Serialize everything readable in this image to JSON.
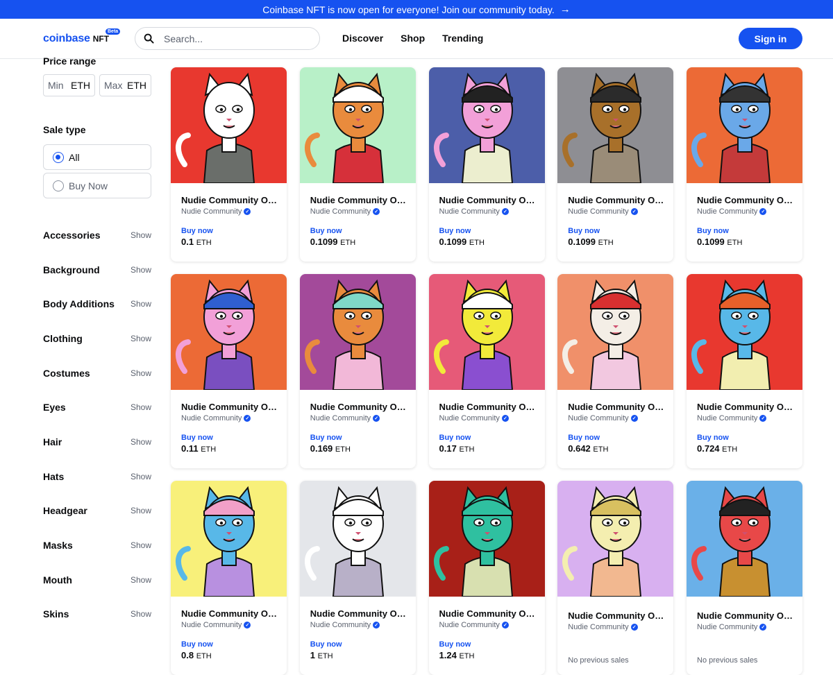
{
  "banner": {
    "text": "Coinbase NFT is now open for everyone! Join our community today."
  },
  "header": {
    "logo_brand": "coinbase",
    "logo_nft": "NFT",
    "logo_beta": "Beta",
    "search_placeholder": "Search...",
    "nav": [
      "Discover",
      "Shop",
      "Trending"
    ],
    "signin": "Sign in"
  },
  "sidebar": {
    "price_range_label": "Price range",
    "min_placeholder": "Min",
    "max_placeholder": "Max",
    "unit": "ETH",
    "sale_type_label": "Sale type",
    "sale_options": [
      {
        "label": "All",
        "selected": true
      },
      {
        "label": "Buy Now",
        "selected": false
      }
    ],
    "show_label": "Show",
    "filters": [
      "Accessories",
      "Background",
      "Body Additions",
      "Clothing",
      "Costumes",
      "Eyes",
      "Hair",
      "Hats",
      "Headgear",
      "Masks",
      "Mouth",
      "Skins"
    ]
  },
  "cards": [
    {
      "title": "Nudie Community O…",
      "collection": "Nudie Community",
      "buy_label": "Buy now",
      "price": "0.1",
      "unit": "ETH",
      "bg": "#e8382f",
      "skin": "#ffffff",
      "shirt": "#6a6e6a",
      "hat": ""
    },
    {
      "title": "Nudie Community O…",
      "collection": "Nudie Community",
      "buy_label": "Buy now",
      "price": "0.1099",
      "unit": "ETH",
      "bg": "#b8f0c8",
      "skin": "#e98b3d",
      "shirt": "#d6303a",
      "hat": "#ffffff"
    },
    {
      "title": "Nudie Community O…",
      "collection": "Nudie Community",
      "buy_label": "Buy now",
      "price": "0.1099",
      "unit": "ETH",
      "bg": "#4c5ea9",
      "skin": "#f2a0d8",
      "shirt": "#eceecf",
      "hat": "#222222"
    },
    {
      "title": "Nudie Community O…",
      "collection": "Nudie Community",
      "buy_label": "Buy now",
      "price": "0.1099",
      "unit": "ETH",
      "bg": "#8e8e93",
      "skin": "#a8702a",
      "shirt": "#9a8c78",
      "hat": "#2b2b2b"
    },
    {
      "title": "Nudie Community O…",
      "collection": "Nudie Community",
      "buy_label": "Buy now",
      "price": "0.1099",
      "unit": "ETH",
      "bg": "#ec6a36",
      "skin": "#6aa8e8",
      "shirt": "#c43a3a",
      "hat": "#333333"
    },
    {
      "title": "Nudie Community O…",
      "collection": "Nudie Community",
      "buy_label": "Buy now",
      "price": "0.11",
      "unit": "ETH",
      "bg": "#ec6a36",
      "skin": "#f2a0d8",
      "shirt": "#7a4fc0",
      "hat": "#2f5fd0"
    },
    {
      "title": "Nudie Community O…",
      "collection": "Nudie Community",
      "buy_label": "Buy now",
      "price": "0.169",
      "unit": "ETH",
      "bg": "#a34a9a",
      "skin": "#e98b3d",
      "shirt": "#f2b8d8",
      "hat": "#7fd8c8"
    },
    {
      "title": "Nudie Community O…",
      "collection": "Nudie Community",
      "buy_label": "Buy now",
      "price": "0.17",
      "unit": "ETH",
      "bg": "#e65a78",
      "skin": "#f2ea3a",
      "shirt": "#8a4fd0",
      "hat": "#ffffff"
    },
    {
      "title": "Nudie Community O…",
      "collection": "Nudie Community",
      "buy_label": "Buy now",
      "price": "0.642",
      "unit": "ETH",
      "bg": "#f0906a",
      "skin": "#f4eee6",
      "shirt": "#f2c8e0",
      "hat": "#d83030"
    },
    {
      "title": "Nudie Community O…",
      "collection": "Nudie Community",
      "buy_label": "Buy now",
      "price": "0.724",
      "unit": "ETH",
      "bg": "#e8382f",
      "skin": "#58b8e8",
      "shirt": "#f2eeb0",
      "hat": "#e8602a"
    },
    {
      "title": "Nudie Community O…",
      "collection": "Nudie Community",
      "buy_label": "Buy now",
      "price": "0.8",
      "unit": "ETH",
      "bg": "#f8f07a",
      "skin": "#58b8e8",
      "shirt": "#b890e0",
      "hat": "#f2a0c8"
    },
    {
      "title": "Nudie Community O…",
      "collection": "Nudie Community",
      "buy_label": "Buy now",
      "price": "1",
      "unit": "ETH",
      "bg": "#e4e6ea",
      "skin": "#ffffff",
      "shirt": "#b8b0c8",
      "hat": "#ffffff"
    },
    {
      "title": "Nudie Community O…",
      "collection": "Nudie Community",
      "buy_label": "Buy now",
      "price": "1.24",
      "unit": "ETH",
      "bg": "#a82018",
      "skin": "#2fc0a0",
      "shirt": "#d8e0b0",
      "hat": "#2fc0a0"
    },
    {
      "title": "Nudie Community O…",
      "collection": "Nudie Community",
      "buy_label": "",
      "price": "",
      "unit": "",
      "no_sales": "No previous sales",
      "bg": "#d8b0f0",
      "skin": "#f4eeb0",
      "shirt": "#f2b890",
      "hat": "#d8c060"
    },
    {
      "title": "Nudie Community O…",
      "collection": "Nudie Community",
      "buy_label": "",
      "price": "",
      "unit": "",
      "no_sales": "No previous sales",
      "bg": "#6ab0e8",
      "skin": "#e84848",
      "shirt": "#c89030",
      "hat": "#222222"
    }
  ]
}
